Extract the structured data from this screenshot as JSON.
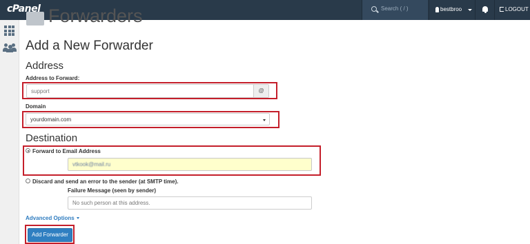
{
  "topbar": {
    "logo": "cPanel",
    "search_placeholder": "Search ( / )",
    "username": "bestbroo",
    "logout_label": "LOGOUT"
  },
  "page": {
    "title": "Forwarders",
    "heading": "Add a New Forwarder"
  },
  "address": {
    "section_title": "Address",
    "forward_label": "Address to Forward:",
    "forward_value": "support",
    "at_symbol": "@",
    "domain_label": "Domain",
    "domain_value": "yourdomain.com"
  },
  "destination": {
    "section_title": "Destination",
    "forward_option_label": "Forward to Email Address",
    "forward_option_selected": true,
    "email_value": "vtkook@mail.ru",
    "discard_option_label": "Discard and send an error to the sender (at SMTP time).",
    "failure_label": "Failure Message (seen by sender)",
    "failure_placeholder": "No such person at this address."
  },
  "advanced_options_label": "Advanced Options",
  "submit_label": "Add Forwarder",
  "colors": {
    "topbar": "#293a4a",
    "highlight_box": "#c41e2a",
    "primary_button": "#2f7fc1",
    "link": "#2d7bbf"
  }
}
